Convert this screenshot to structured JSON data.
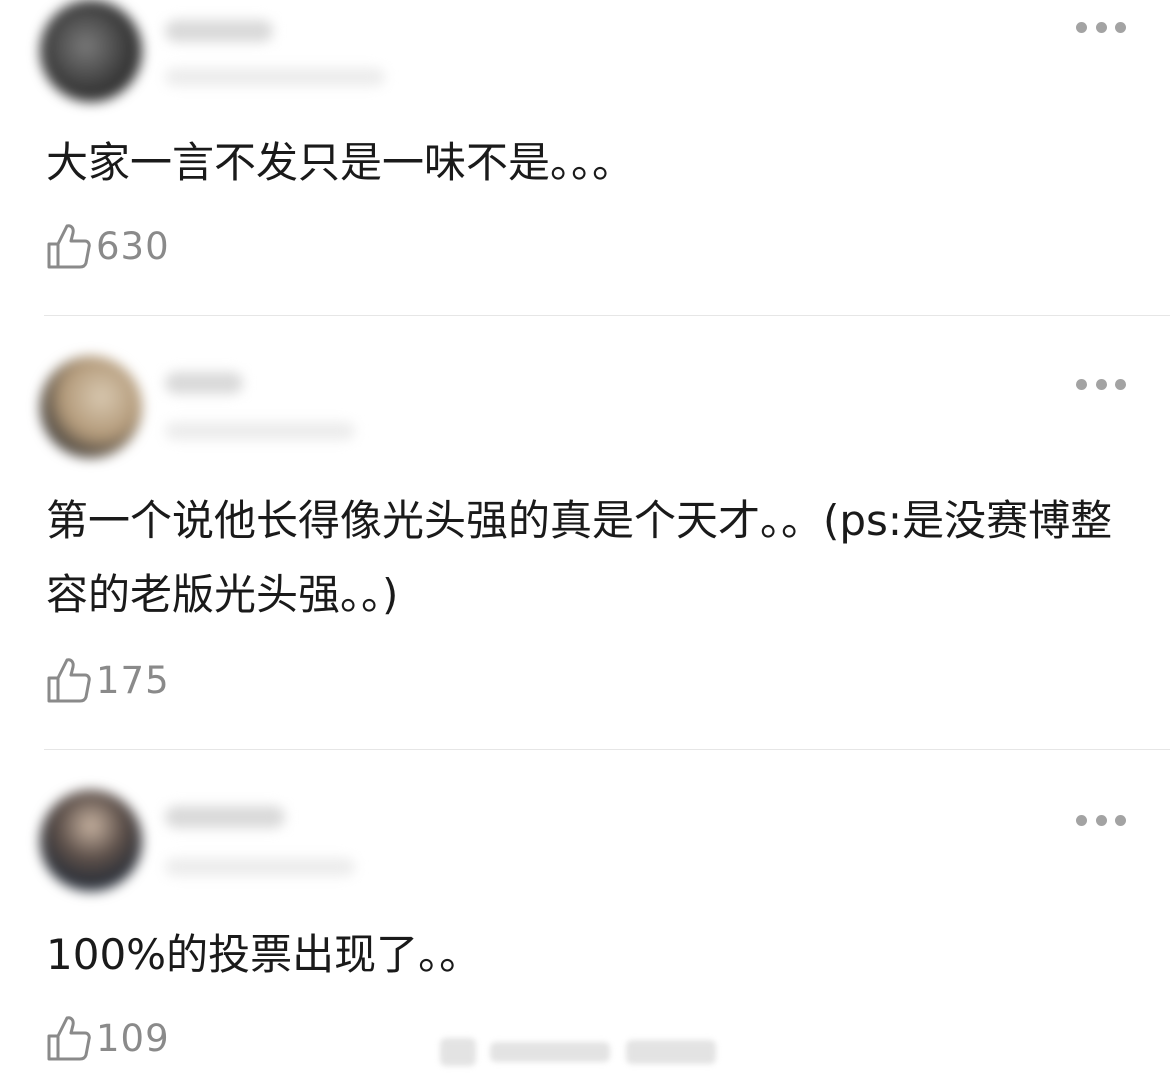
{
  "comments": [
    {
      "text": "大家一言不发只是一味不是。。。",
      "likes": "630"
    },
    {
      "text": "第一个说他长得像光头强的真是个天才。。(ps:是没赛博整容的老版光头强。。)",
      "likes": "175"
    },
    {
      "text": "100%的投票出现了。。",
      "likes": "109"
    }
  ],
  "icons": {
    "like": "thumbs-up-icon",
    "more": "more-dots-icon"
  },
  "colors": {
    "text": "#1a1a1a",
    "muted": "#8a8a8a",
    "divider": "#e6e6e6",
    "dots": "#a3a3a3"
  }
}
